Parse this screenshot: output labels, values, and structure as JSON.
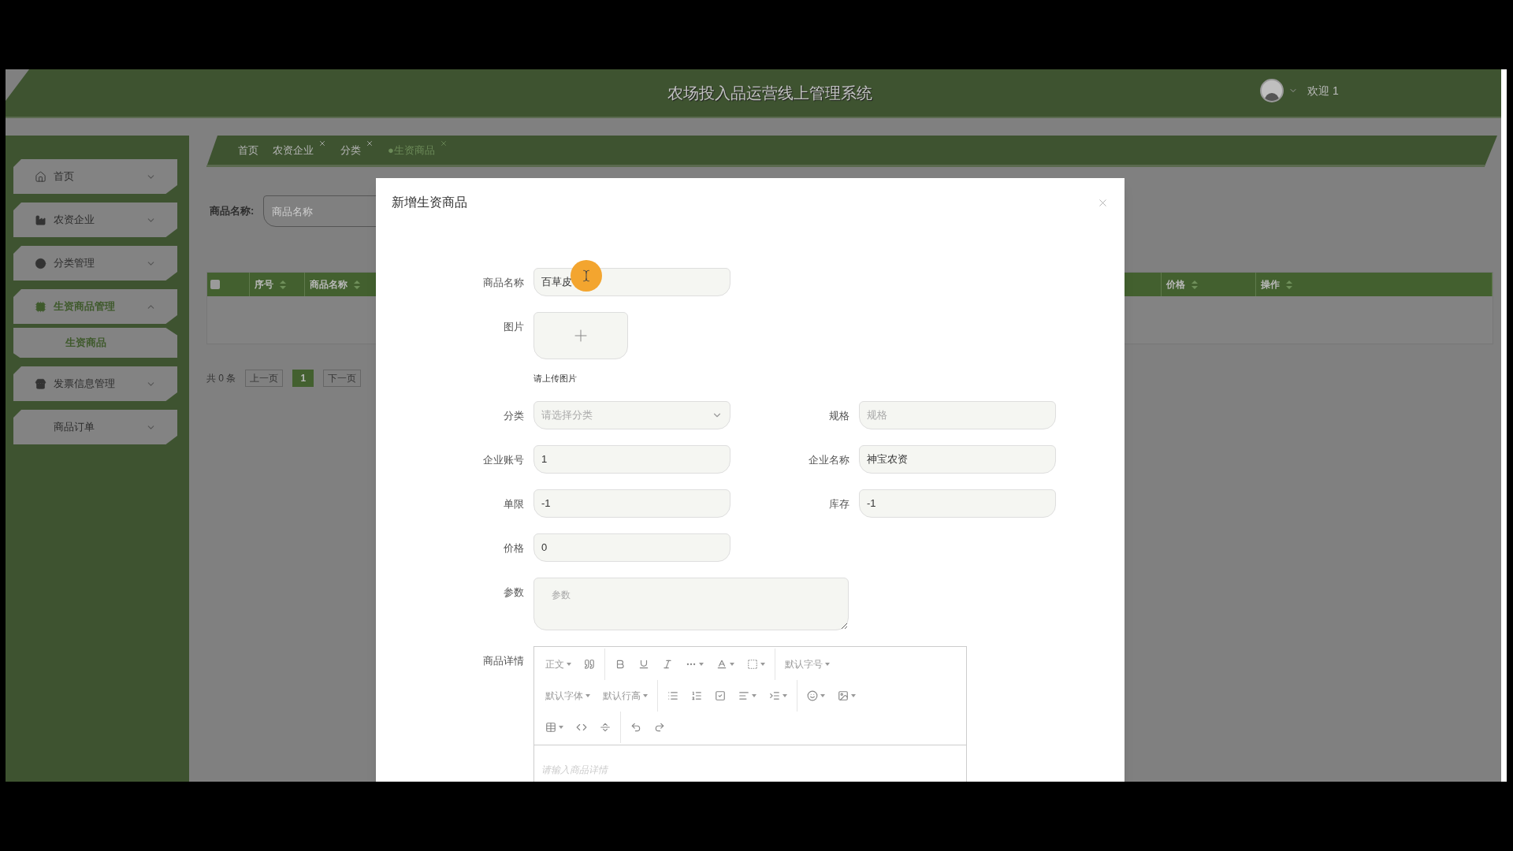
{
  "header": {
    "title": "农场投入品运营线上管理系统",
    "user": "欢迎 1"
  },
  "sidebar": {
    "items": [
      {
        "label": "首页",
        "expanded": false,
        "selected": false
      },
      {
        "label": "农资企业",
        "expanded": false,
        "selected": false
      },
      {
        "label": "分类管理",
        "expanded": false,
        "selected": false
      },
      {
        "label": "生资商品管理",
        "expanded": true,
        "selected": true,
        "children": [
          {
            "label": "生资商品",
            "selected": true
          }
        ]
      },
      {
        "label": "发票信息管理",
        "expanded": false,
        "selected": false
      },
      {
        "label": "商品订单",
        "expanded": false,
        "selected": false
      }
    ]
  },
  "tabs": [
    {
      "label": "首页",
      "closable": false,
      "selected": false
    },
    {
      "label": "农资企业",
      "closable": true,
      "selected": false
    },
    {
      "label": "分类",
      "closable": true,
      "selected": false
    },
    {
      "label": "●生资商品",
      "closable": true,
      "selected": true
    }
  ],
  "search": {
    "label": "商品名称:",
    "placeholder": "商品名称"
  },
  "table": {
    "select_all_checked": false,
    "columns": [
      "序号",
      "商品名称",
      "价格",
      "操作"
    ]
  },
  "pagination": {
    "total": "共 0 条",
    "prev": "上一页",
    "pages": [
      {
        "label": "1",
        "selected": true
      }
    ],
    "next": "下一页"
  },
  "dialog": {
    "title": "新增生资商品",
    "rows": [
      {
        "fields": [
          {
            "kind": "text",
            "label": "商品名称",
            "value": "百草皮"
          }
        ]
      },
      {
        "fields": [
          {
            "kind": "upload",
            "label": "图片",
            "hint": "请上传图片"
          }
        ]
      },
      {
        "fields": [
          {
            "kind": "select",
            "label": "分类",
            "placeholder": "请选择分类"
          },
          {
            "kind": "text",
            "label": "规格",
            "placeholder": "规格"
          }
        ]
      },
      {
        "fields": [
          {
            "kind": "text",
            "label": "企业账号",
            "value": "1"
          },
          {
            "kind": "text",
            "label": "企业名称",
            "value": "神宝农资"
          }
        ]
      },
      {
        "fields": [
          {
            "kind": "text",
            "label": "单限",
            "value": "-1"
          },
          {
            "kind": "text",
            "label": "库存",
            "value": "-1"
          }
        ]
      },
      {
        "fields": [
          {
            "kind": "text",
            "label": "价格",
            "value": "0"
          }
        ]
      },
      {
        "fields": [
          {
            "kind": "textarea",
            "label": "参数",
            "placeholder": "参数"
          }
        ]
      },
      {
        "fields": [
          {
            "kind": "editor",
            "label": "商品详情",
            "placeholder": "请输入商品详情",
            "toolbar": [
              [
                {
                  "kind": "text",
                  "label": "正文",
                  "dropdown": true
                },
                {
                  "kind": "icon",
                  "dropdown": false
                },
                {
                  "kind": "separator"
                },
                {
                  "kind": "icon",
                  "dropdown": false
                },
                {
                  "kind": "icon",
                  "dropdown": false
                },
                {
                  "kind": "icon",
                  "dropdown": false
                },
                {
                  "kind": "icon",
                  "dropdown": true
                },
                {
                  "kind": "icon",
                  "dropdown": true
                },
                {
                  "kind": "icon",
                  "dropdown": true
                },
                {
                  "kind": "separator"
                },
                {
                  "kind": "text",
                  "label": "默认字号",
                  "dropdown": true
                }
              ],
              [
                {
                  "kind": "text",
                  "label": "默认字体",
                  "dropdown": true
                },
                {
                  "kind": "text",
                  "label": "默认行高",
                  "dropdown": true
                },
                {
                  "kind": "separator"
                },
                {
                  "kind": "icon",
                  "dropdown": false
                },
                {
                  "kind": "icon",
                  "dropdown": false
                },
                {
                  "kind": "icon",
                  "dropdown": false
                },
                {
                  "kind": "icon",
                  "dropdown": true
                },
                {
                  "kind": "icon",
                  "dropdown": true
                },
                {
                  "kind": "separator"
                },
                {
                  "kind": "icon",
                  "dropdown": true
                },
                {
                  "kind": "icon",
                  "dropdown": true
                }
              ],
              [
                {
                  "kind": "icon",
                  "dropdown": true
                },
                {
                  "kind": "icon",
                  "dropdown": false
                },
                {
                  "kind": "icon",
                  "dropdown": false
                },
                {
                  "kind": "separator"
                },
                {
                  "kind": "icon",
                  "dropdown": false
                },
                {
                  "kind": "icon",
                  "dropdown": false
                }
              ]
            ]
          }
        ]
      }
    ]
  }
}
